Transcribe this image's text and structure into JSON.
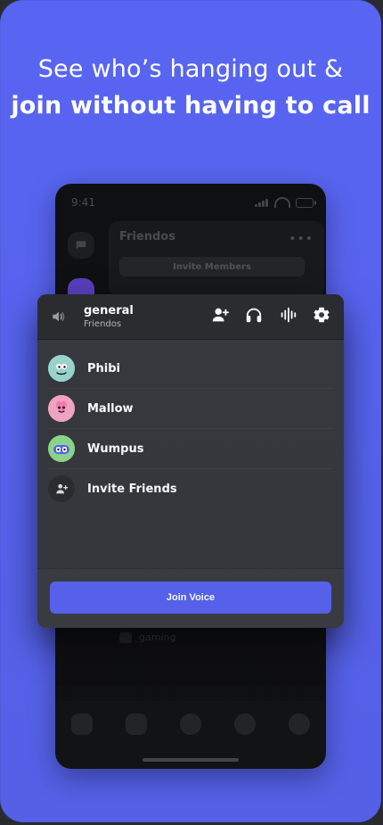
{
  "hero": {
    "line1": "See who’s hanging out &",
    "line2": "join without having to call"
  },
  "phone": {
    "time": "9:41",
    "server_name": "Friendos",
    "invite_members_label": "Invite Members",
    "background_channel": "gaming"
  },
  "popup": {
    "channel_name": "general",
    "server_name": "Friendos",
    "members": [
      {
        "name": "Phibi",
        "avatar_color": "#9cd8d0"
      },
      {
        "name": "Mallow",
        "avatar_color": "#f4a7c6"
      },
      {
        "name": "Wumpus",
        "avatar_color": "#8ed98f"
      }
    ],
    "invite_label": "Invite Friends",
    "join_label": "Join Voice"
  },
  "colors": {
    "brand": "#5865f2",
    "popup_bg": "#37393f",
    "popup_header": "#2b2d31"
  }
}
